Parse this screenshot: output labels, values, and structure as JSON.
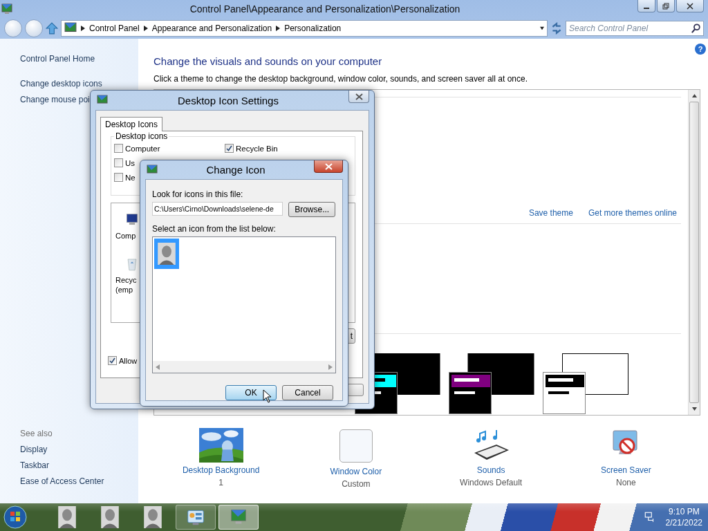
{
  "window": {
    "title": "Control Panel\\Appearance and Personalization\\Personalization"
  },
  "address_bar": {
    "breadcrumbs": [
      "Control Panel",
      "Appearance and Personalization",
      "Personalization"
    ]
  },
  "search": {
    "placeholder": "Search Control Panel"
  },
  "help_button": "?",
  "sidebar": {
    "items": [
      "Control Panel Home",
      "Change desktop icons",
      "Change mouse poi"
    ],
    "see_also_title": "See also",
    "see_also": [
      "Display",
      "Taskbar",
      "Ease of Access Center"
    ]
  },
  "content": {
    "heading": "Change the visuals and sounds on your computer",
    "description": "Click a theme to change the desktop background, window color, sounds, and screen saver all at once.",
    "links": [
      "Save theme",
      "Get more themes online"
    ],
    "themes": [
      {
        "color": "#00ffff"
      },
      {
        "color": "#800080"
      },
      {
        "color": "#ffffff"
      }
    ]
  },
  "settings": [
    {
      "kind": "background",
      "label": "Desktop Background",
      "value": "1"
    },
    {
      "kind": "color",
      "label": "Window Color",
      "value": "Custom"
    },
    {
      "kind": "sounds",
      "label": "Sounds",
      "value": "Windows Default"
    },
    {
      "kind": "screensaver",
      "label": "Screen Saver",
      "value": "None"
    }
  ],
  "desktop_icon_settings": {
    "title": "Desktop Icon Settings",
    "tabs": [
      {
        "label": "Desktop Icons",
        "selected": true
      }
    ],
    "group_title": "Desktop icons",
    "checkboxes": [
      {
        "label": "Computer",
        "checked": false
      },
      {
        "label": "Us",
        "checked": false
      },
      {
        "label": "Ne",
        "checked": false
      },
      {
        "label": "Recycle Bin",
        "checked": true
      }
    ],
    "icons": [
      {
        "kind": "computer",
        "lines": [
          "Comp"
        ]
      },
      {
        "kind": "recycle",
        "lines": [
          "Recyc",
          "(emp"
        ]
      }
    ],
    "button_fragment": "t",
    "allow": {
      "label": "Allow",
      "checked": true
    }
  },
  "change_icon": {
    "title": "Change Icon",
    "file_label": "Look for icons in this file:",
    "file_value": "C:\\Users\\Cirno\\Downloads\\selene-de",
    "browse": "Browse...",
    "list_label": "Select an icon from the list below:",
    "icons": [
      {
        "selected": true
      }
    ],
    "buttons": [
      "OK",
      "Cancel"
    ]
  },
  "taskbar": {
    "buttons": [
      {
        "kind": "face",
        "selected": false
      },
      {
        "kind": "face",
        "selected": false
      },
      {
        "kind": "face",
        "selected": false
      },
      {
        "kind": "control-panel",
        "selected": false
      },
      {
        "kind": "personalization",
        "selected": true
      }
    ],
    "time": "9:10 PM",
    "date": "2/21/2022"
  }
}
